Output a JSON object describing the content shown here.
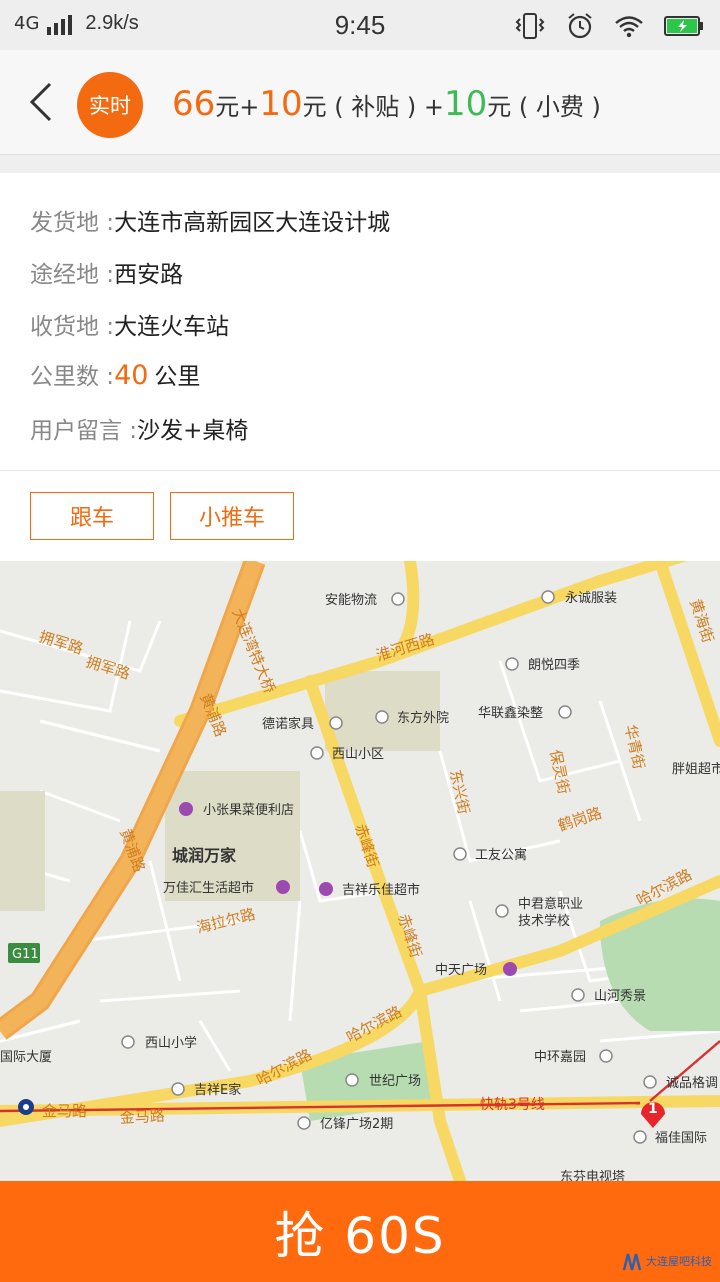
{
  "status_bar": {
    "network": "4G",
    "speed": "2.9k/s",
    "time": "9:45"
  },
  "header": {
    "badge": "实时",
    "price": {
      "base": "66",
      "base_unit": "元+",
      "subsidy": "10",
      "subsidy_unit": "元 ( 补贴 ) +",
      "tip": "10",
      "tip_unit": "元 ( 小费 )"
    }
  },
  "order": {
    "origin_label": "发货地 :",
    "origin": "大连市高新园区大连设计城",
    "via_label": "途经地 :",
    "via": "西安路",
    "dest_label": "收货地 :",
    "dest": "大连火车站",
    "distance_label": "公里数 :",
    "distance": "40",
    "distance_unit": "公里",
    "note_label": "用户留言 :",
    "note": "沙发+桌椅"
  },
  "tags": [
    "跟车",
    "小推车"
  ],
  "map": {
    "roads": [
      "淮河西路",
      "大连湾特大桥",
      "黄浦路",
      "拥军路",
      "拥军路",
      "黄浦路",
      "东兴街",
      "保灵街",
      "华青街",
      "鹤岗路",
      "赤峰街",
      "赤峰街",
      "哈尔滨路",
      "哈尔滨路",
      "哈尔滨路",
      "海拉尔路",
      "金马路",
      "金马路",
      "快轨3号线",
      "黄海街",
      "G11"
    ],
    "pois": [
      "安能物流",
      "永诚服装",
      "朗悦四季",
      "德诺家具",
      "东方外院",
      "华联鑫染整",
      "西山小区",
      "胖姐超市",
      "小张果菜便利店",
      "城润万家",
      "工友公寓",
      "万佳汇生活超市",
      "吉祥乐佳超市",
      "中君意职业",
      "技术学校",
      "中天广场",
      "山河秀景",
      "西山小学",
      "国际大厦",
      "中环嘉园",
      "世纪广场",
      "吉祥E家",
      "诚品格调",
      "亿锋广场2期",
      "福佳国际",
      "东芬电视塔"
    ],
    "marker": "1"
  },
  "grab_button": "抢 60S",
  "watermark": "大连屋吧科技"
}
